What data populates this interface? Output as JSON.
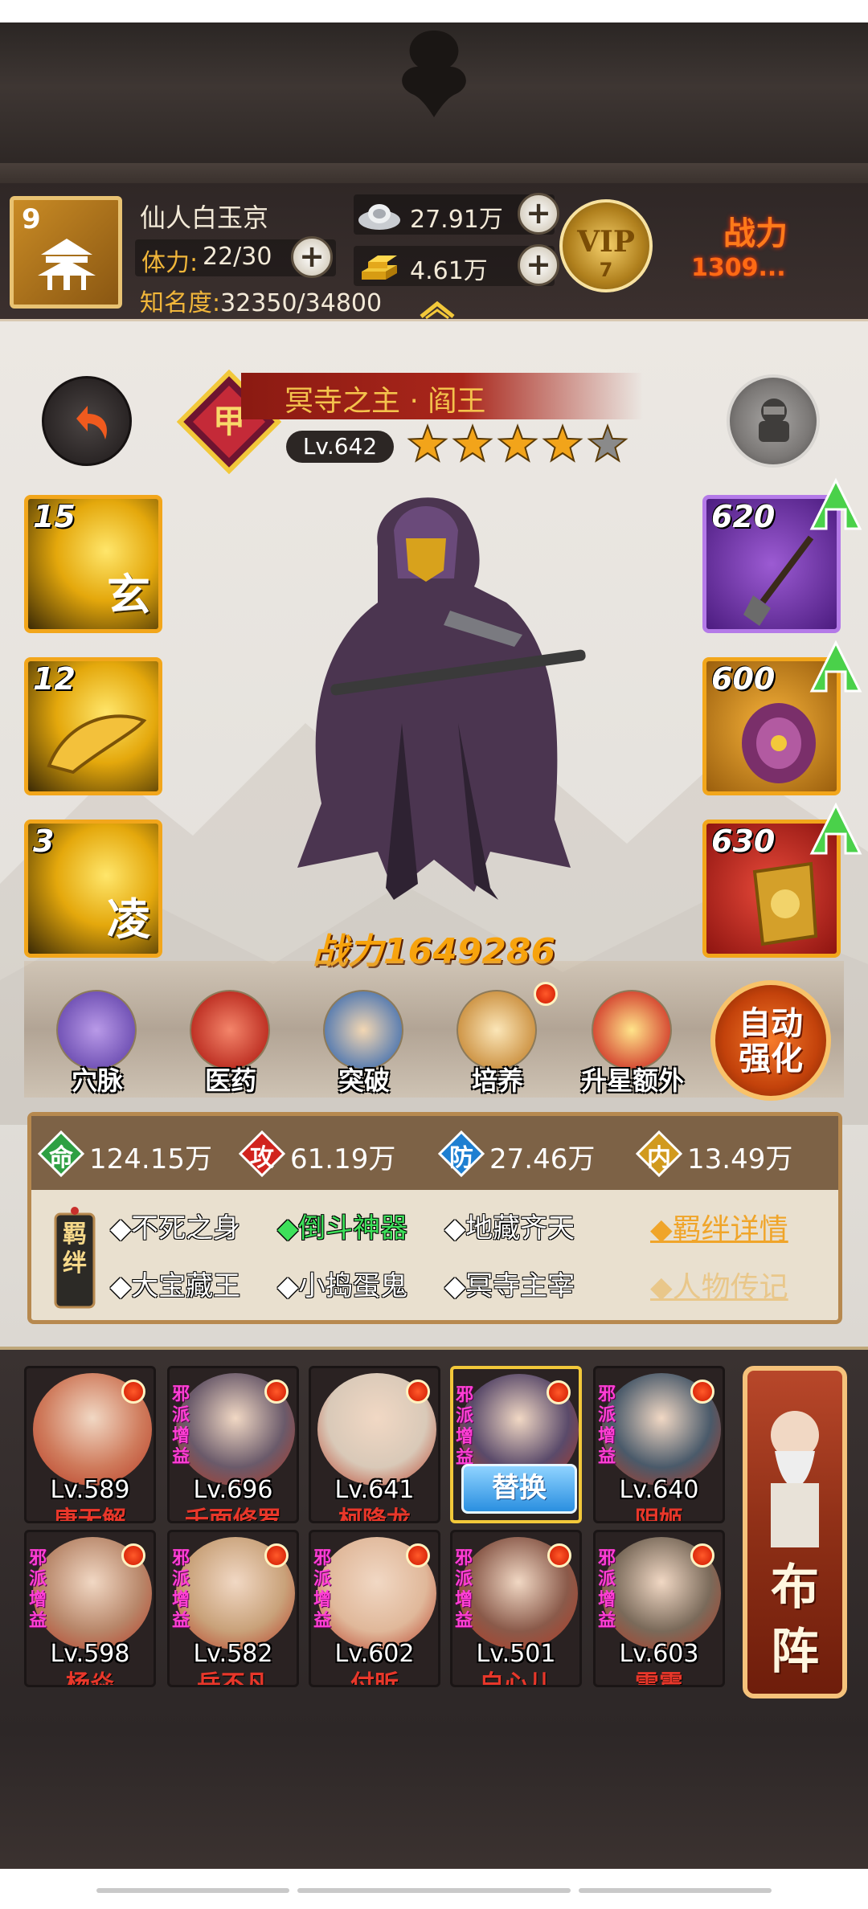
{
  "player": {
    "level": "9",
    "name": "仙人白玉京",
    "stamina_label": "体力:",
    "stamina_value": "22/30",
    "fame_label": "知名度:",
    "fame_value": "32350/34800",
    "silver": "27.91万",
    "gold": "4.61万",
    "vip_label": "VIP",
    "vip_level": "7",
    "power_label": "战力",
    "power_value": "1309..."
  },
  "character": {
    "title": "冥寺之主 · 阎王",
    "level": "Lv.642",
    "stars_filled": 4,
    "stars_total": 5,
    "power": "战力1649286"
  },
  "skills": [
    {
      "num": "15",
      "glyph": "玄"
    },
    {
      "num": "12",
      "glyph": ""
    },
    {
      "num": "3",
      "glyph": "凌"
    }
  ],
  "equipment": [
    {
      "num": "620"
    },
    {
      "num": "600"
    },
    {
      "num": "630"
    }
  ],
  "functions": [
    {
      "label": "穴脉"
    },
    {
      "label": "医药"
    },
    {
      "label": "突破"
    },
    {
      "label": "培养"
    },
    {
      "label": "升星额外"
    }
  ],
  "auto_button": {
    "line1": "自动",
    "line2": "强化"
  },
  "stats": [
    {
      "key": "命",
      "value": "124.15万",
      "color": "#2ea043"
    },
    {
      "key": "攻",
      "value": "61.19万",
      "color": "#d1241e"
    },
    {
      "key": "防",
      "value": "27.46万",
      "color": "#1e7fd1"
    },
    {
      "key": "内",
      "value": "13.49万",
      "color": "#d19a1e"
    }
  ],
  "bonds_label": "羁绊",
  "bonds": [
    {
      "text": "◆不死之身",
      "active": false
    },
    {
      "text": "◆倒斗神器",
      "active": true
    },
    {
      "text": "◆地藏齐天",
      "active": false
    },
    {
      "text": "◆大宝藏王",
      "active": false
    },
    {
      "text": "◆小捣蛋鬼",
      "active": false
    },
    {
      "text": "◆冥寺主宰",
      "active": false
    }
  ],
  "links": {
    "bond_detail": "◆羁绊详情",
    "biography": "◆人物传记"
  },
  "team": [
    {
      "lv": "Lv.589",
      "name": "唐无解",
      "evil": false
    },
    {
      "lv": "Lv.696",
      "name": "千面修罗",
      "evil": true
    },
    {
      "lv": "Lv.641",
      "name": "柯降龙",
      "evil": false
    },
    {
      "lv": "",
      "name": "",
      "evil": true,
      "replace": "替换"
    },
    {
      "lv": "Lv.640",
      "name": "阴姬",
      "evil": true
    },
    {
      "lv": "Lv.598",
      "name": "杨焱",
      "evil": true
    },
    {
      "lv": "Lv.582",
      "name": "岳不凡",
      "evil": true
    },
    {
      "lv": "Lv.602",
      "name": "付昕",
      "evil": true
    },
    {
      "lv": "Lv.501",
      "name": "白心儿",
      "evil": true
    },
    {
      "lv": "Lv.603",
      "name": "雷震",
      "evil": true
    }
  ],
  "evil_tag": "邪派增益",
  "formation_label": "布阵"
}
